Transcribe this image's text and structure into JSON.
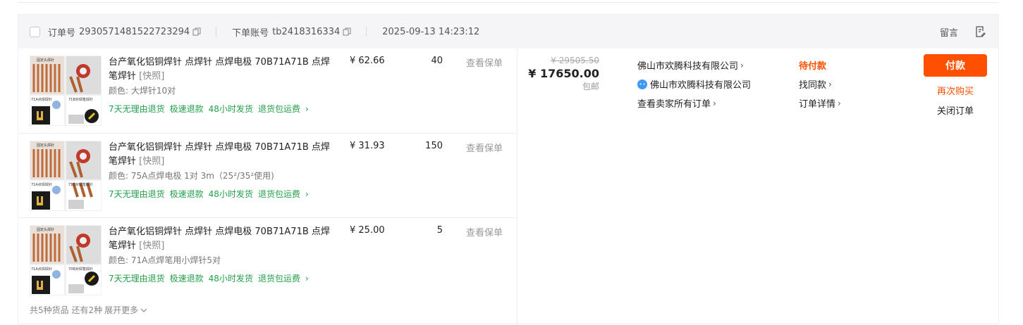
{
  "order": {
    "order_no_label": "订单号",
    "order_no": "2930571481522723294",
    "account_label": "下单账号",
    "account": "tb2418316334",
    "datetime": "2025-09-13 14:23:12",
    "message_label": "留言"
  },
  "items": [
    {
      "title": "台产氧化铝铜焊针 点焊针 点焊电极 70B71A71B 点焊笔焊针",
      "tag": "[快照]",
      "spec": "颜色: 大焊针10对",
      "price": "¥ 62.66",
      "qty": "40",
      "insurance": "查看保单",
      "services": [
        "7天无理由退货",
        "极速退款",
        "48小时发货",
        "退货包运费"
      ]
    },
    {
      "title": "台产氧化铝铜焊针 点焊针 点焊电极 70B71A71B 点焊笔焊针",
      "tag": "[快照]",
      "spec": "颜色: 75A点焊电极 1对 3m（25²/35²使用)",
      "price": "¥ 31.93",
      "qty": "150",
      "insurance": "查看保单",
      "services": [
        "7天无理由退货",
        "极速退款",
        "48小时发货",
        "退货包运费"
      ]
    },
    {
      "title": "台产氧化铝铜焊针 点焊针 点焊电极 70B71A71B 点焊笔焊针",
      "tag": "[快照]",
      "spec": "颜色: 71A点焊笔用小焊针5对",
      "price": "¥ 25.00",
      "qty": "5",
      "insurance": "查看保单",
      "services": [
        "7天无理由退货",
        "极速退款",
        "48小时发货",
        "退货包运费"
      ]
    }
  ],
  "footer": {
    "summary": "共5种货品 还有2种",
    "expand": "展开更多"
  },
  "amount": {
    "original": "¥ 29505.50",
    "total": "¥ 17650.00",
    "shipping": "包邮"
  },
  "seller": {
    "shop": "佛山市欢腾科技有限公司",
    "contact": "佛山市欢腾科技有限公司",
    "all_orders": "查看卖家所有订单"
  },
  "status": {
    "text": "待付款",
    "find_similar": "找同款",
    "details": "订单详情"
  },
  "actions": {
    "pay": "付款",
    "rebuy": "再次购买",
    "close": "关闭订单"
  },
  "colors": {
    "accent": "#ff5000",
    "service_green": "#23a04a",
    "header_bg": "#f5f5f7"
  },
  "thumbnail_labels": {
    "top": "固定头焊针",
    "right_top": "70B对焊笔焊针",
    "bottom_left": "71A点焊焊针",
    "bottom_right": "71B对焊笔焊针"
  }
}
